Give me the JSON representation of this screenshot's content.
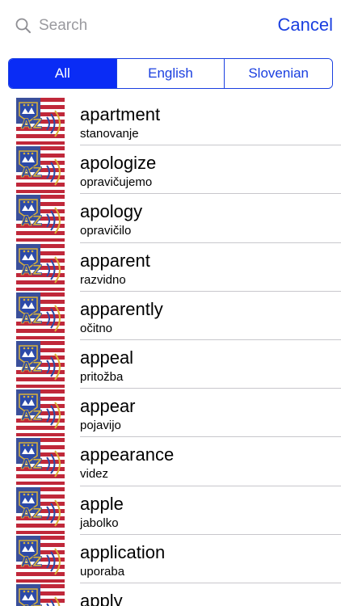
{
  "search": {
    "placeholder": "Search",
    "cancel_label": "Cancel"
  },
  "filter_tabs": [
    {
      "label": "All",
      "selected": true
    },
    {
      "label": "English",
      "selected": false
    },
    {
      "label": "Slovenian",
      "selected": false
    }
  ],
  "entries": [
    {
      "word": "apartment",
      "translation": "stanovanje"
    },
    {
      "word": "apologize",
      "translation": "opravičujemo"
    },
    {
      "word": "apology",
      "translation": "opravičilo"
    },
    {
      "word": "apparent",
      "translation": "razvidno"
    },
    {
      "word": "apparently",
      "translation": "očitno"
    },
    {
      "word": "appeal",
      "translation": "pritožba"
    },
    {
      "word": "appear",
      "translation": "pojavijo"
    },
    {
      "word": "appearance",
      "translation": "videz"
    },
    {
      "word": "apple",
      "translation": "jabolko"
    },
    {
      "word": "application",
      "translation": "uporaba"
    },
    {
      "word": "apply",
      "translation": ""
    }
  ],
  "colors": {
    "accent": "#1a3fe0",
    "selected_segment": "#0a2cf5",
    "separator": "#c8c7cc"
  },
  "icons": {
    "search": "magnifier-icon",
    "entry_flag": "slovenia-usa-flag-icon"
  }
}
